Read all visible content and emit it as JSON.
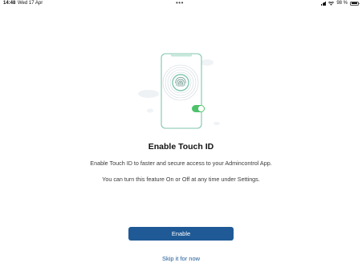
{
  "status_bar": {
    "time": "14:48",
    "date": "Wed 17 Apr",
    "battery_text": "98 %",
    "battery_level": 0.98
  },
  "content": {
    "title": "Enable Touch ID",
    "description_1": "Enable Touch ID to faster and secure access to your Admincontrol App.",
    "description_2": "You can turn this feature On or Off at any time under Settings.",
    "enable_label": "Enable",
    "skip_label": "Skip it for now"
  },
  "icons": {
    "illustration": "phone-fingerprint-icon",
    "toggle": "toggle-on-icon"
  },
  "colors": {
    "primary": "#1f5a96",
    "accent_green": "#4cc26a",
    "phone_outline": "#7fc6ae"
  }
}
